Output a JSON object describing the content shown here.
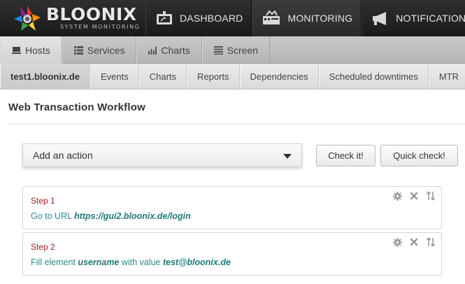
{
  "brand": {
    "name": "BLOONIX",
    "tagline": "SYSTEM MONITORING"
  },
  "topnav": [
    {
      "label": "DASHBOARD",
      "icon": "dashboard-icon"
    },
    {
      "label": "MONITORING",
      "icon": "monitoring-icon",
      "active": true
    },
    {
      "label": "NOTIFICATIONS",
      "icon": "megaphone-icon"
    }
  ],
  "tabs": [
    {
      "label": "Hosts",
      "icon": "server-icon",
      "active": true
    },
    {
      "label": "Services",
      "icon": "list-icon"
    },
    {
      "label": "Charts",
      "icon": "bar-chart-icon"
    },
    {
      "label": "Screen",
      "icon": "screen-icon"
    }
  ],
  "subnav": [
    {
      "label": "test1.bloonix.de",
      "active": true
    },
    {
      "label": "Events"
    },
    {
      "label": "Charts"
    },
    {
      "label": "Reports"
    },
    {
      "label": "Dependencies"
    },
    {
      "label": "Scheduled downtimes"
    },
    {
      "label": "MTR"
    }
  ],
  "page": {
    "title": "Web Transaction Workflow"
  },
  "action_select": {
    "label": "Add an action"
  },
  "buttons": {
    "check": "Check it!",
    "quick_check": "Quick check!"
  },
  "steps": [
    {
      "title": "Step 1",
      "text1": "Go to URL ",
      "value1": "https://gui2.bloonix.de/login"
    },
    {
      "title": "Step 2",
      "text1": "Fill element ",
      "value1": "username",
      "text2": " with value ",
      "value2": "test@bloonix.de"
    }
  ],
  "colors": {
    "header_bg": "#1b1b1b",
    "step_title": "#a31f1f",
    "step_text": "#2a8c8c"
  }
}
